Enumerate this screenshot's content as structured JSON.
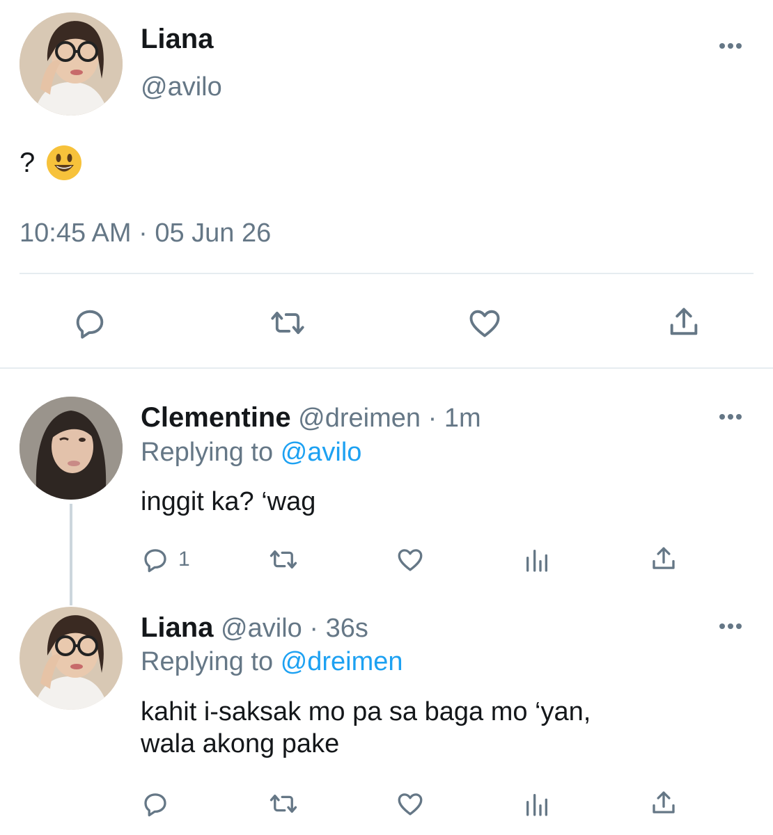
{
  "main_tweet": {
    "name": "Liana",
    "handle": "@avilo",
    "text": "?",
    "emoji": "😃",
    "timestamp": "10:45 AM · 05 Jun 26",
    "actions": [
      "reply-icon",
      "retweet-icon",
      "like-icon",
      "share-icon"
    ]
  },
  "replies": [
    {
      "name": "Clementine",
      "handle": "@dreimen",
      "separator": "·",
      "time": "1m",
      "replying_prefix": "Replying to",
      "replying_to": "@avilo",
      "text": "inggit ka? ‘wag",
      "reply_count": "1",
      "actions": [
        "reply-icon",
        "retweet-icon",
        "like-icon",
        "analytics-icon",
        "share-icon"
      ]
    },
    {
      "name": "Liana",
      "handle": "@avilo",
      "separator": "·",
      "time": "36s",
      "replying_prefix": "Replying to",
      "replying_to": "@dreimen",
      "text_line1": "kahit i-saksak mo pa sa baga mo ‘yan,",
      "text_line2": "wala akong pake",
      "actions": [
        "reply-icon",
        "retweet-icon",
        "like-icon",
        "analytics-icon",
        "share-icon"
      ]
    }
  ],
  "colors": {
    "text": "#14171a",
    "secondary": "#657786",
    "link": "#1da1f2",
    "divider": "#e6ecf0"
  }
}
